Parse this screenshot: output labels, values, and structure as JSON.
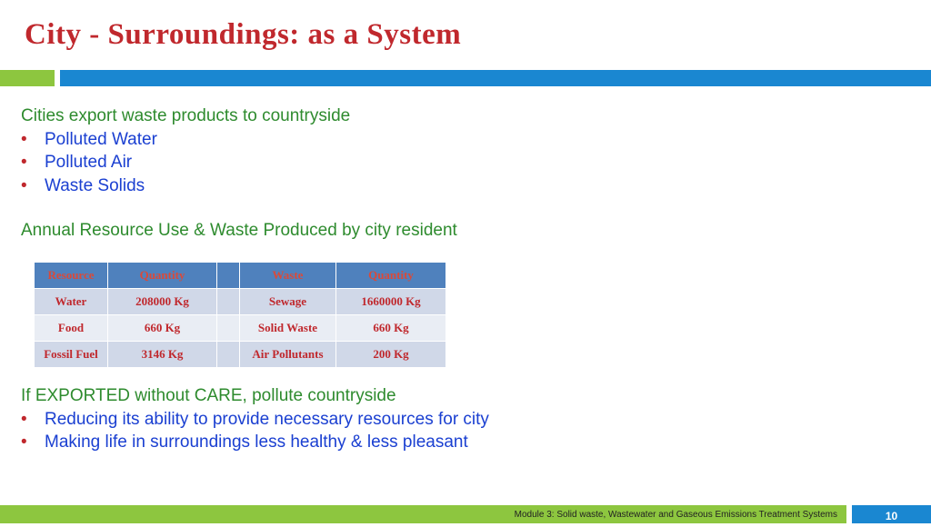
{
  "slide": {
    "title": "City - Surroundings: as a System",
    "section1": {
      "heading": "Cities export waste products to countryside",
      "bullets": [
        "Polluted Water",
        "Polluted Air",
        "Waste Solids"
      ]
    },
    "section2_heading": "Annual Resource Use & Waste Produced by city resident",
    "table": {
      "headers": [
        "Resource",
        "Quantity",
        "",
        "Waste",
        "Quantity"
      ],
      "rows": [
        [
          "Water",
          "208000 Kg",
          "",
          "Sewage",
          "1660000 Kg"
        ],
        [
          "Food",
          "660 Kg",
          "",
          "Solid Waste",
          "660 Kg"
        ],
        [
          "Fossil Fuel",
          "3146 Kg",
          "",
          "Air Pollutants",
          "200 Kg"
        ]
      ]
    },
    "section3": {
      "heading": "If EXPORTED without CARE, pollute countryside",
      "bullets": [
        "Reducing its ability to provide necessary resources for city",
        "Making life in surroundings less healthy & less pleasant"
      ]
    },
    "bullet_char": "•",
    "footer": {
      "module": "Module 3: Solid waste, Wastewater and Gaseous Emissions Treatment Systems",
      "page_number": "10"
    }
  }
}
